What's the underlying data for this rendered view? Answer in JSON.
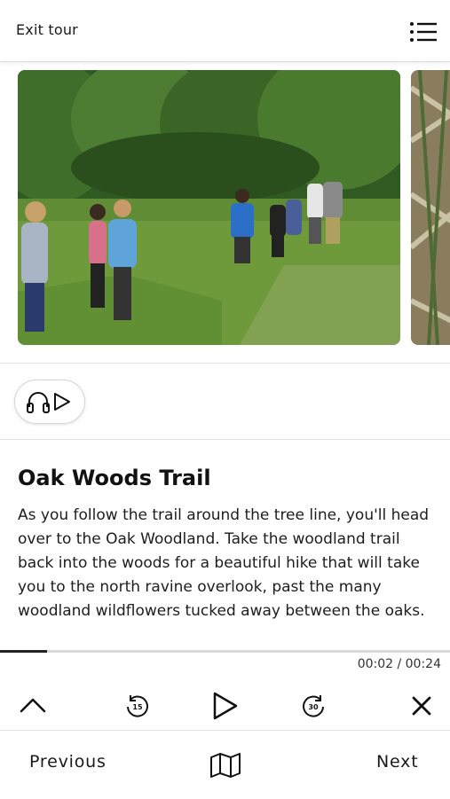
{
  "header": {
    "exit_label": "Exit tour",
    "menu_icon": "list-menu-icon"
  },
  "media": {
    "slides": [
      {
        "icon": "photo-icon"
      },
      {
        "icon": "photo-icon"
      }
    ]
  },
  "audio": {
    "icon": "headphones-play-icon"
  },
  "stop": {
    "title": "Oak Woods Trail",
    "description": "As you follow the trail around the tree line, you'll head over to the Oak Woodland. Take the woodland trail back into the woods for a beautiful hike that will take you to the north ravine overlook, past the many woodland wildflowers tucked away between the oaks."
  },
  "player": {
    "time_display": "00:02 / 00:24",
    "progress_fraction": 0.105,
    "rewind_seconds": "15",
    "forward_seconds": "30",
    "icons": [
      "chevron-up-icon",
      "rewind-15-icon",
      "play-icon",
      "forward-30-icon",
      "close-icon"
    ]
  },
  "navigation": {
    "previous_label": "Previous",
    "next_label": "Next",
    "map_icon": "map-icon"
  },
  "colors": {
    "text": "#111111",
    "divider": "#e2e2e2",
    "progress": "#222222"
  }
}
